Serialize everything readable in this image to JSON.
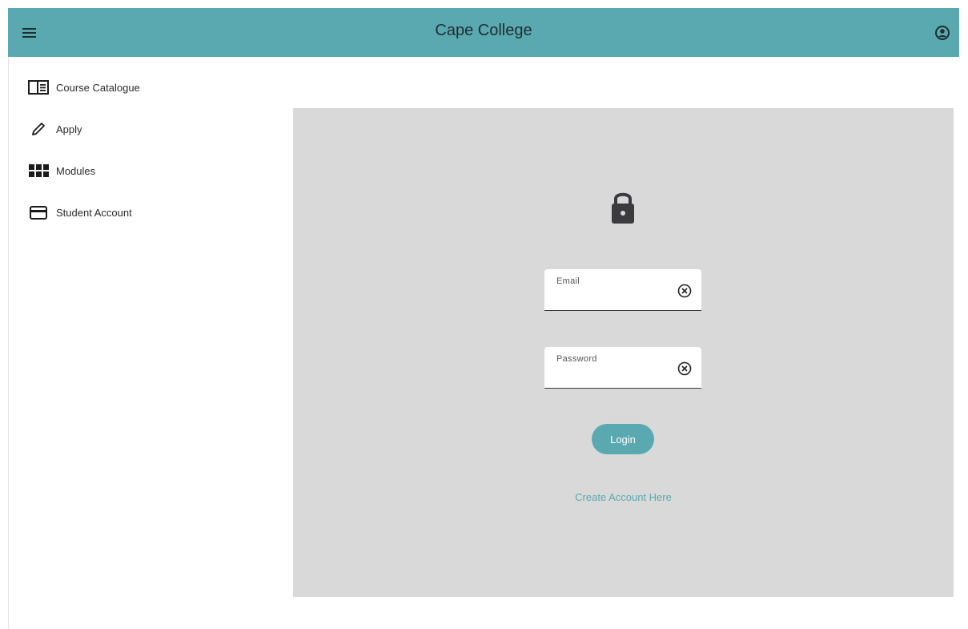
{
  "app": {
    "title": "Cape College",
    "accent_color": "#5aa9b1"
  },
  "header": {
    "menu_icon": "menu-icon",
    "account_icon": "account-circle-icon"
  },
  "sidebar": {
    "items": [
      {
        "label": "Course Catalogue",
        "icon": "book-open-icon"
      },
      {
        "label": "Apply",
        "icon": "pencil-icon"
      },
      {
        "label": "Modules",
        "icon": "grid-icon"
      },
      {
        "label": "Student Account",
        "icon": "credit-card-icon"
      }
    ]
  },
  "login": {
    "lock_icon": "lock-icon",
    "email": {
      "label": "Email",
      "value": ""
    },
    "password": {
      "label": "Password",
      "value": ""
    },
    "button_label": "Login",
    "create_account_label": "Create Account Here"
  }
}
